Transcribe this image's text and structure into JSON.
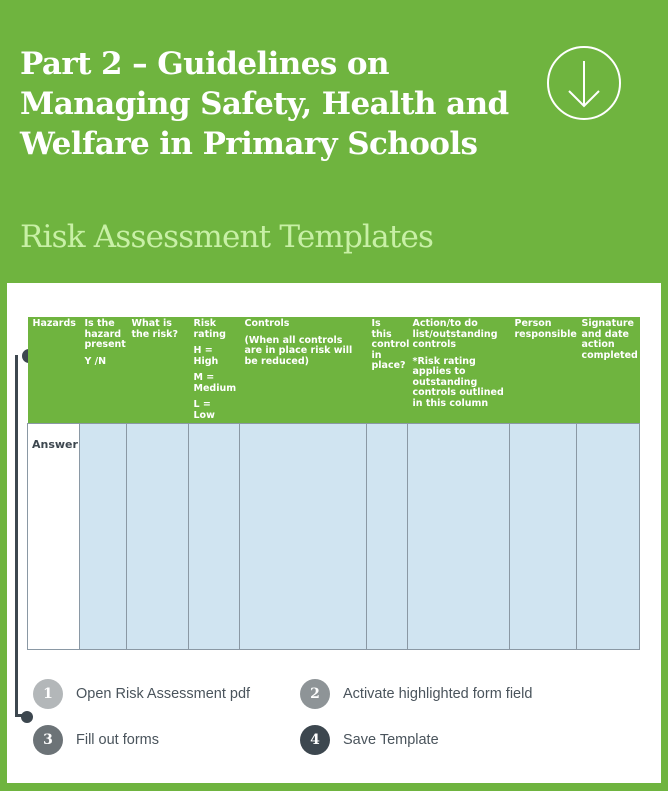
{
  "header": {
    "title": "Part 2 – Guidelines on Managing Safety, Health and Welfare in Primary Schools",
    "subtitle": "Risk Assessment Templates",
    "download_icon": "arrow-down-circle-icon"
  },
  "colors": {
    "brand_green": "#6fb43f",
    "subtitle_green": "#c8f0a6",
    "field_highlight": "#d0e4f1",
    "dark_slate": "#3d474f"
  },
  "table": {
    "columns": [
      {
        "title": "Hazards",
        "notes": []
      },
      {
        "title": "Is the hazard present",
        "notes": [
          "Y /N"
        ]
      },
      {
        "title": "What is the risk?",
        "notes": []
      },
      {
        "title": "Risk rating",
        "notes": [
          "H = High",
          "M = Medium",
          "L = Low"
        ]
      },
      {
        "title": "Controls",
        "notes": [
          "(When all controls are in place risk will be reduced)"
        ]
      },
      {
        "title": "Is this control in place?",
        "notes": []
      },
      {
        "title": "Action/to do list/outstanding controls",
        "notes": [
          "*Risk rating applies to outstanding controls outlined in this column"
        ]
      },
      {
        "title": "Person responsible",
        "notes": []
      },
      {
        "title": "Signature and date action completed",
        "notes": []
      }
    ],
    "row_label": "Answer",
    "answers": [
      "",
      "",
      "",
      "",
      "",
      "",
      "",
      ""
    ]
  },
  "steps": [
    {
      "number": "1",
      "label": "Open Risk Assessment pdf",
      "color": "#b3b7b9"
    },
    {
      "number": "2",
      "label": "Activate highlighted form field",
      "color": "#8e9497"
    },
    {
      "number": "3",
      "label": "Fill out forms",
      "color": "#6c7377"
    },
    {
      "number": "4",
      "label": "Save Template",
      "color": "#3d474f"
    }
  ]
}
